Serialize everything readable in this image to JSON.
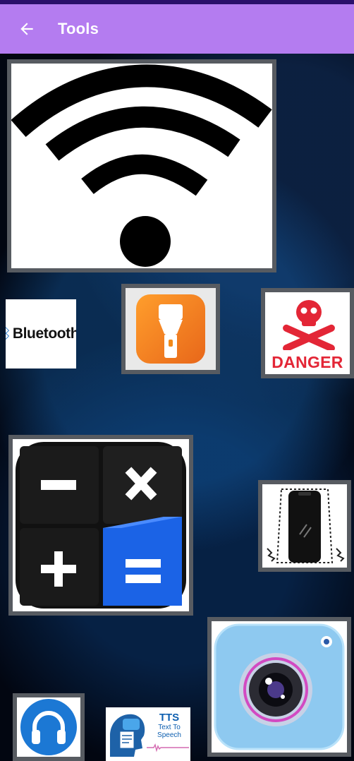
{
  "appbar": {
    "title": "Tools",
    "background": "#b47cf0",
    "back_icon": "arrow-left-icon"
  },
  "tools": [
    {
      "id": "wifi",
      "icon": "wifi-icon"
    },
    {
      "id": "bluetooth",
      "icon": "bluetooth-icon",
      "label": "Bluetooth"
    },
    {
      "id": "flashlight",
      "icon": "flashlight-icon"
    },
    {
      "id": "danger",
      "icon": "skull-crossbones-icon",
      "label": "DANGER"
    },
    {
      "id": "calculator",
      "icon": "calculator-icon"
    },
    {
      "id": "vibrate",
      "icon": "phone-vibrate-icon"
    },
    {
      "id": "camera",
      "icon": "camera-icon"
    },
    {
      "id": "headphones",
      "icon": "headphones-icon"
    },
    {
      "id": "tts",
      "icon": "text-to-speech-icon",
      "title": "TTS",
      "subtitle": "Text To Speech"
    }
  ],
  "colors": {
    "tile_border": "#575b61",
    "danger_red": "#e32636",
    "flashlight_orange": "#f28a1a",
    "calculator_blue": "#1b63e6",
    "camera_blue": "#8ec9f0",
    "headphones_blue": "#1c78d4"
  }
}
